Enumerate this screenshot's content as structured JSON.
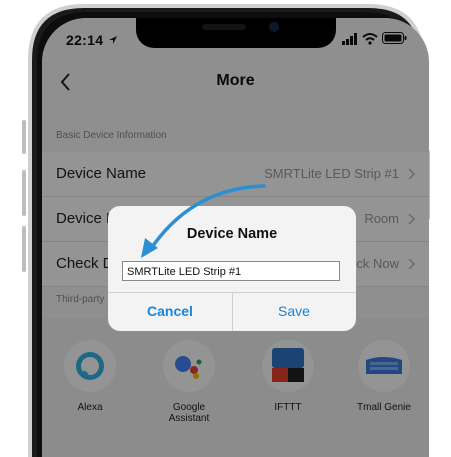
{
  "status_bar": {
    "time": "22:14"
  },
  "nav": {
    "title": "More"
  },
  "section": {
    "basic_info": "Basic Device Information",
    "third_party": "Third-party"
  },
  "rows": [
    {
      "label": "Device Name",
      "value": "SMRTLite LED Strip #1"
    },
    {
      "label": "Device Location",
      "value": "Room"
    },
    {
      "label": "Check Device Network",
      "value": "Check Now"
    }
  ],
  "third_party": [
    {
      "label": "Alexa",
      "icon": "alexa-icon"
    },
    {
      "label": "Google\nAssistant",
      "icon": "google-assistant-icon"
    },
    {
      "label": "IFTTT",
      "icon": "ifttt-icon"
    },
    {
      "label": "Tmall Genie",
      "icon": "tmall-genie-icon"
    }
  ],
  "dialog": {
    "title": "Device Name",
    "input_value": "SMRTLite LED Strip #1",
    "cancel": "Cancel",
    "save": "Save"
  },
  "colors": {
    "accent": "#1a84d8",
    "annotation_arrow": "#2a8fd3"
  }
}
